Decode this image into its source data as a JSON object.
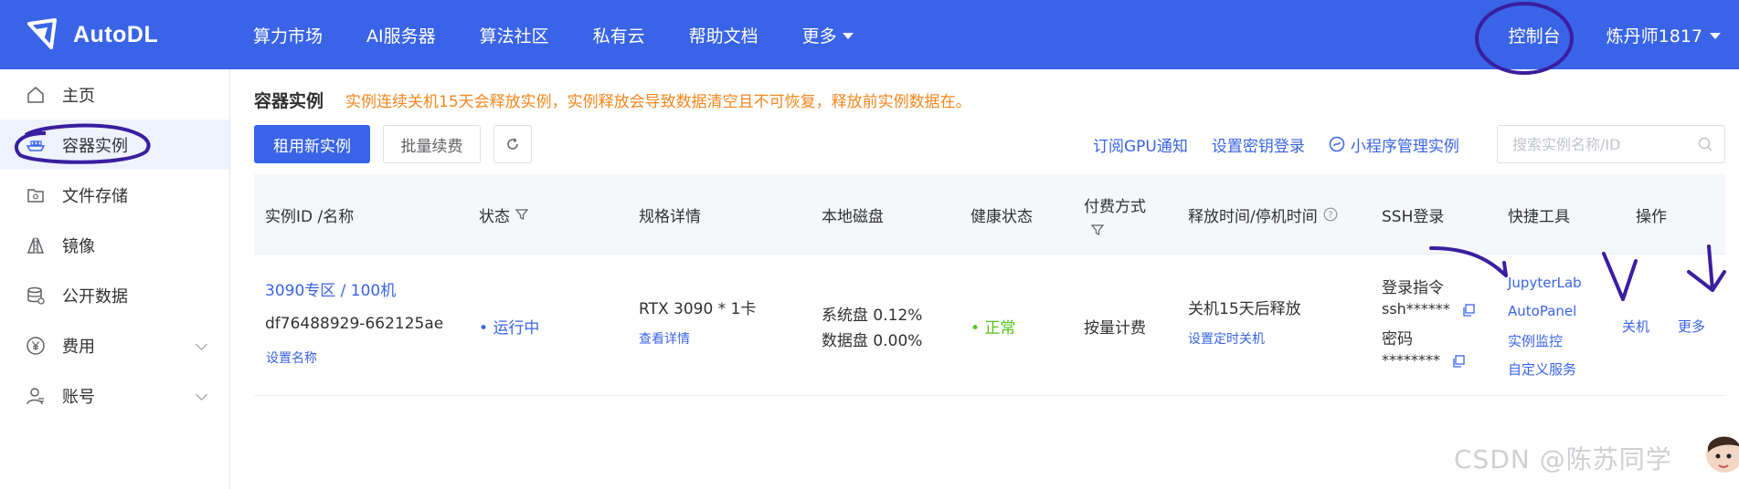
{
  "header": {
    "logo_text": "AutoDL",
    "nav": [
      "算力市场",
      "AI服务器",
      "算法社区",
      "私有云",
      "帮助文档",
      "更多"
    ],
    "console": "控制台",
    "user": "炼丹师1817"
  },
  "sidebar": {
    "items": [
      {
        "label": "主页",
        "icon": "home-icon"
      },
      {
        "label": "容器实例",
        "icon": "container-icon"
      },
      {
        "label": "文件存储",
        "icon": "storage-icon"
      },
      {
        "label": "镜像",
        "icon": "image-icon"
      },
      {
        "label": "公开数据",
        "icon": "database-icon"
      },
      {
        "label": "费用",
        "icon": "yen-icon"
      },
      {
        "label": "账号",
        "icon": "user-icon"
      }
    ]
  },
  "main": {
    "title": "容器实例",
    "warning": "实例连续关机15天会释放实例，实例释放会导致数据清空且不可恢复，释放前实例数据在。",
    "buttons": {
      "rent": "租用新实例",
      "renew": "批量续费"
    },
    "links": {
      "gpu_notify": "订阅GPU通知",
      "ssh_key": "设置密钥登录",
      "mini_program": "小程序管理实例"
    },
    "search_placeholder": "搜索实例名称/ID"
  },
  "table": {
    "headers": {
      "id": "实例ID /名称",
      "status": "状态",
      "spec": "规格详情",
      "disk": "本地磁盘",
      "health": "健康状态",
      "billing": "付费方式",
      "release": "释放时间/停机时间",
      "ssh": "SSH登录",
      "tools": "快捷工具",
      "ops": "操作"
    },
    "row": {
      "name": "3090专区 / 100机",
      "id": "df76488929-662125ae",
      "set_name": "设置名称",
      "status": "运行中",
      "spec": "RTX 3090 * 1卡",
      "spec_detail": "查看详情",
      "sys_disk": "系统盘 0.12%",
      "data_disk": "数据盘 0.00%",
      "health": "正常",
      "billing": "按量计费",
      "release": "关机15天后释放",
      "release_action": "设置定时关机",
      "ssh_cmd_label": "登录指令",
      "ssh_cmd": "ssh******",
      "ssh_pwd_label": "密码",
      "ssh_pwd": "********",
      "tools": [
        "JupyterLab",
        "AutoPanel",
        "实例监控",
        "自定义服务"
      ],
      "ops": [
        "关机",
        "更多"
      ]
    }
  },
  "watermark": "CSDN @陈苏同学",
  "colors": {
    "brand": "#3a64e7",
    "warning": "#f5871f",
    "success": "#52c41a",
    "annotation": "#3a1ea0"
  }
}
